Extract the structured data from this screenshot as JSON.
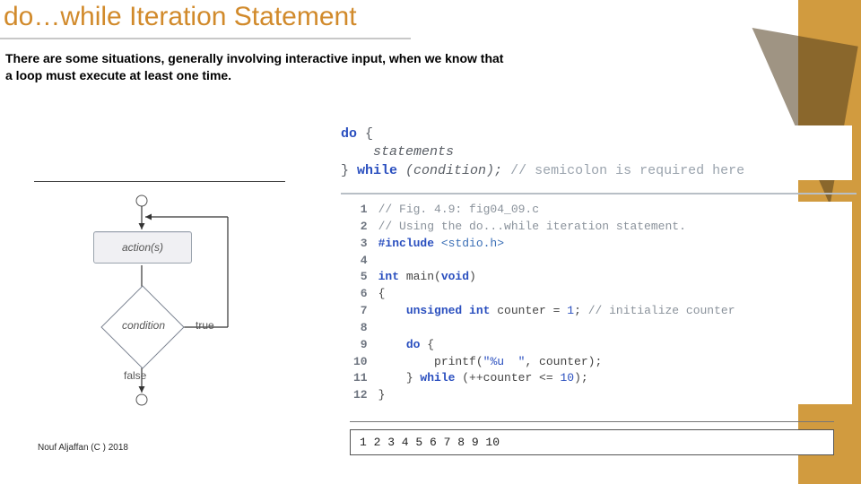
{
  "title": "do…while Iteration Statement",
  "intro": "There are some situations, generally involving interactive input, when we know that a loop must execute at least one time.",
  "syntax": {
    "kw_do": "do",
    "brace_open": " {",
    "stmts": "    statements",
    "brace_close": "} ",
    "kw_while": "while",
    "cond": " (condition); ",
    "comment": "// semicolon is required here"
  },
  "flow": {
    "action": "action(s)",
    "cond": "condition",
    "t": "true",
    "f": "false"
  },
  "code": {
    "l1": "// Fig. 4.9: fig04_09.c",
    "l2": "// Using the do...while iteration statement.",
    "l3a": "#include ",
    "l3b": "<stdio.h>",
    "l4": "",
    "l5a": "int",
    "l5b": " main(",
    "l5c": "void",
    "l5d": ")",
    "l6": "{",
    "l7a": "    unsigned int",
    "l7b": " counter = ",
    "l7c": "1",
    "l7d": "; ",
    "l7e": "// initialize counter",
    "l8": "",
    "l9a": "    do",
    "l9b": " {",
    "l10a": "        printf(",
    "l10b": "\"%u  \"",
    "l10c": ", counter);",
    "l11a": "    } ",
    "l11b": "while",
    "l11c": " (++counter <= ",
    "l11d": "10",
    "l11e": ");",
    "l12": "}"
  },
  "output": "1  2  3  4  5  6  7  8  9  10",
  "footer": "Nouf Aljaffan (C ) 2018",
  "chart_data": {
    "type": "flowchart",
    "title": "do…while control flow",
    "nodes": [
      {
        "id": "start",
        "kind": "connector"
      },
      {
        "id": "action",
        "kind": "process",
        "label": "action(s)"
      },
      {
        "id": "cond",
        "kind": "decision",
        "label": "condition"
      },
      {
        "id": "end",
        "kind": "connector"
      }
    ],
    "edges": [
      {
        "from": "start",
        "to": "action"
      },
      {
        "from": "action",
        "to": "cond"
      },
      {
        "from": "cond",
        "to": "action",
        "label": "true"
      },
      {
        "from": "cond",
        "to": "end",
        "label": "false"
      }
    ]
  }
}
